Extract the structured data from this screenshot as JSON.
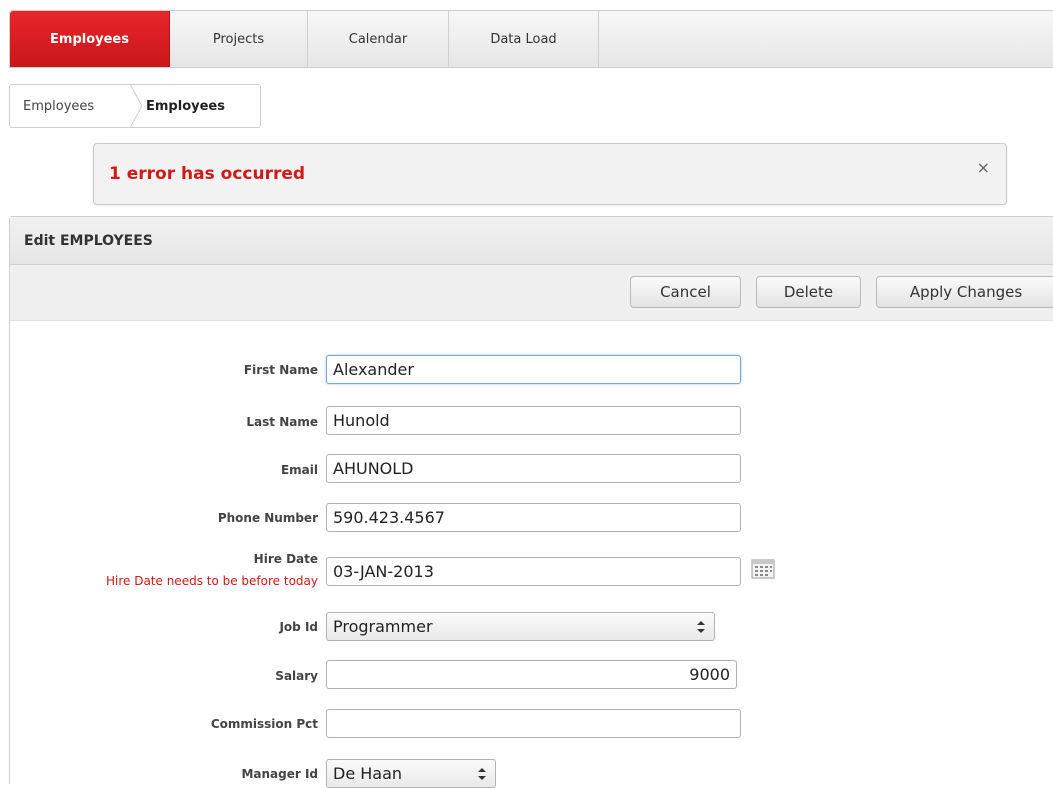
{
  "tabs": [
    {
      "label": "Employees",
      "active": true
    },
    {
      "label": "Projects",
      "active": false
    },
    {
      "label": "Calendar",
      "active": false
    },
    {
      "label": "Data Load",
      "active": false
    }
  ],
  "breadcrumb": [
    "Employees",
    "Employees"
  ],
  "alert": {
    "message": "1 error has occurred",
    "close": "×"
  },
  "region": {
    "title": "Edit EMPLOYEES"
  },
  "buttons": {
    "cancel": "Cancel",
    "delete": "Delete",
    "apply": "Apply Changes"
  },
  "form": {
    "first_name": {
      "label": "First Name",
      "value": "Alexander"
    },
    "last_name": {
      "label": "Last Name",
      "value": "Hunold"
    },
    "email": {
      "label": "Email",
      "value": "AHUNOLD"
    },
    "phone": {
      "label": "Phone Number",
      "value": "590.423.4567"
    },
    "hire_date": {
      "label": "Hire Date",
      "value": "03-JAN-2013",
      "error": "Hire Date needs to be before today"
    },
    "job_id": {
      "label": "Job Id",
      "value": "Programmer"
    },
    "salary": {
      "label": "Salary",
      "value": "9000"
    },
    "commission": {
      "label": "Commission Pct",
      "value": ""
    },
    "manager_id": {
      "label": "Manager Id",
      "value": "De Haan"
    }
  },
  "colors": {
    "accent": "#d01919",
    "tab_active": "#d9201f",
    "focus_border": "#7aa7d6"
  },
  "icons": {
    "calendar": "calendar-icon",
    "close": "close-icon",
    "select": "select-arrows-icon"
  }
}
